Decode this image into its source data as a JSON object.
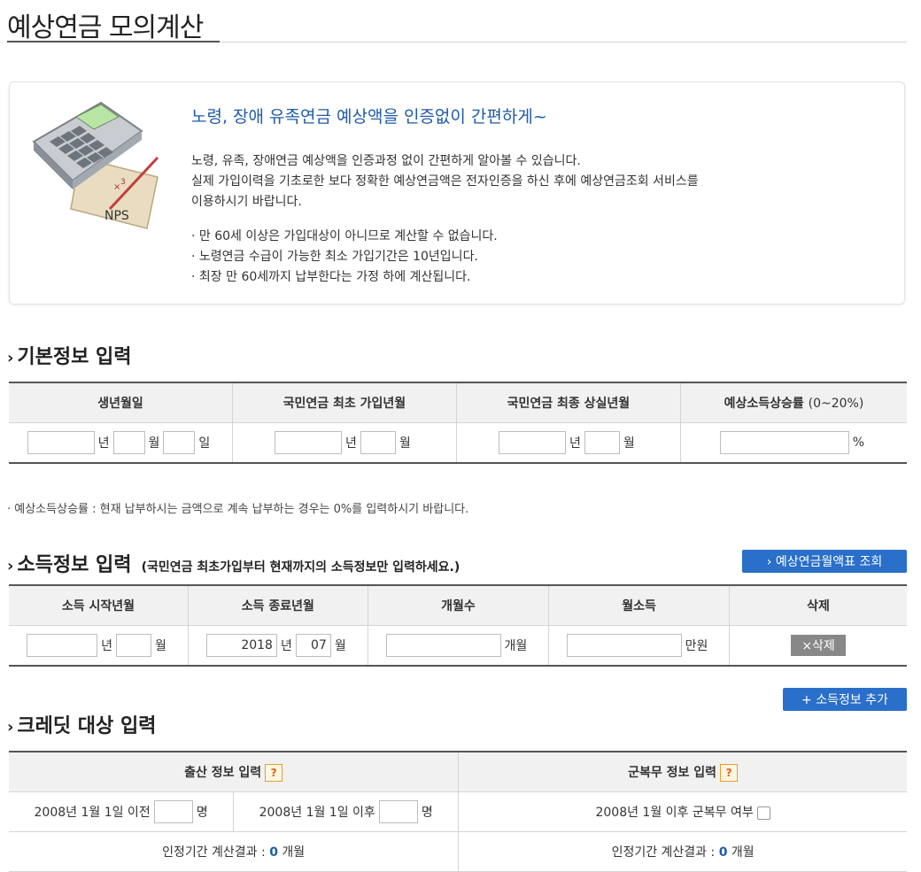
{
  "page": {
    "title": "예상연금 모의계산"
  },
  "intro": {
    "heading": "노령, 장애 유족연금 예상액을 인증없이 간편하게~",
    "icon_label": "NPS",
    "lines": [
      "노령, 유족, 장애연금 예상액을 인증과정 없이 간편하게 알아볼 수 있습니다.",
      "실제 가입이력을 기초로한 보다 정확한 예상연금액은 전자인증을 하신 후에 예상연금조회 서비스를",
      "이용하시기 바랍니다."
    ],
    "notes": [
      "· 만 60세 이상은 가입대상이 아니므로 계산할 수 없습니다.",
      "· 노령연금 수급이 가능한 최소 가입기간은 10년입니다.",
      "· 최장 만 60세까지 납부한다는 가정 하에 계산됩니다."
    ]
  },
  "basic": {
    "title": "기본정보 입력",
    "headers": [
      "생년월일",
      "국민연금 최초 가입년월",
      "국민연금 최종 상실년월",
      "예상소득상승률"
    ],
    "rate_range": "(0~20%)",
    "units": {
      "year": "년",
      "month": "월",
      "day": "일",
      "percent": "%"
    },
    "note": "· 예상소득상승률 : 현재 납부하시는 금액으로 계속 납부하는 경우는 0%를 입력하시기 바랍니다."
  },
  "income": {
    "title": "소득정보 입력",
    "subtitle": "(국민연금 최초가입부터 현재까지의 소득정보만 입력하세요.)",
    "lookup_button": "› 예상연금월액표 조회",
    "headers": [
      "소득 시작년월",
      "소득 종료년월",
      "개월수",
      "월소득",
      "삭제"
    ],
    "end_year": "2018",
    "end_month": "07",
    "units": {
      "year": "년",
      "month": "월",
      "months": "개월",
      "manwon": "만원"
    },
    "delete_button": "×삭제",
    "add_button": "+ 소득정보 추가"
  },
  "credit": {
    "title": "크레딧 대상 입력",
    "birth_header": "출산 정보 입력",
    "military_header": "군복무 정보 입력",
    "qmark": "?",
    "birth_before": "2008년 1월 1일 이전",
    "birth_after": "2008년 1월 1일 이후",
    "person_unit": "명",
    "military_label": "2008년 1월 이후 군복무 여부",
    "result_label": "인정기간 계산결과 :",
    "result_birth": "0",
    "result_military": "0",
    "result_unit": "개월"
  }
}
